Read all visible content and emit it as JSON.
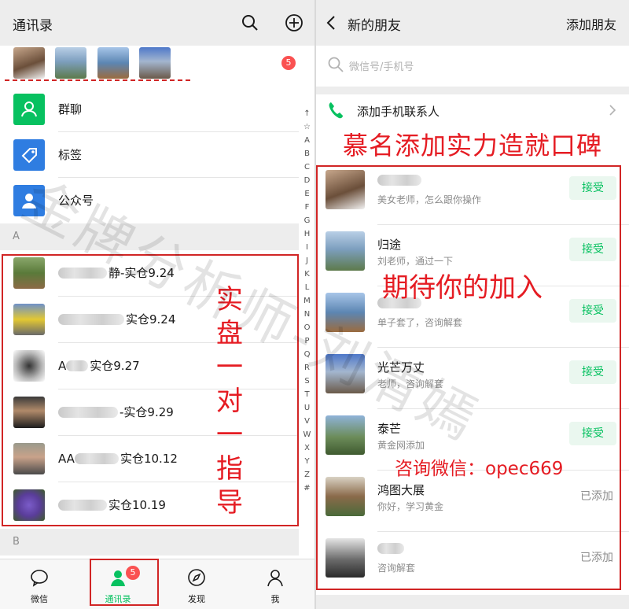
{
  "left": {
    "title": "通讯录",
    "new_friends_badge": "5",
    "menu": [
      {
        "label": "群聊",
        "icon": "group-chat-icon",
        "color": "#07c160"
      },
      {
        "label": "标签",
        "icon": "tag-icon",
        "color": "#2f7de1"
      },
      {
        "label": "公众号",
        "icon": "official-account-icon",
        "color": "#2f7de1"
      }
    ],
    "section_a": "A",
    "section_b": "B",
    "contacts": [
      {
        "prefix": "",
        "suffix": "静-实仓9.24"
      },
      {
        "prefix": "",
        "suffix": "实仓9.24"
      },
      {
        "prefix": "A",
        "suffix": "实仓9.27"
      },
      {
        "prefix": "",
        "suffix": "-实仓9.29"
      },
      {
        "prefix": "AA",
        "suffix": "实仓10.12"
      },
      {
        "prefix": "",
        "suffix": "实仓10.19"
      }
    ],
    "alphabet": [
      "↑",
      "☆",
      "A",
      "B",
      "C",
      "D",
      "E",
      "F",
      "G",
      "H",
      "I",
      "J",
      "K",
      "L",
      "M",
      "N",
      "O",
      "P",
      "Q",
      "R",
      "S",
      "T",
      "U",
      "V",
      "W",
      "X",
      "Y",
      "Z",
      "#"
    ],
    "tabs": [
      {
        "label": "微信",
        "icon": "chat-icon"
      },
      {
        "label": "通讯录",
        "icon": "contacts-icon",
        "badge": "5"
      },
      {
        "label": "发现",
        "icon": "compass-icon"
      },
      {
        "label": "我",
        "icon": "me-icon"
      }
    ],
    "overlay_vertical": [
      "实",
      "盘",
      "一",
      "对",
      "一",
      "指",
      "导"
    ]
  },
  "right": {
    "title": "新的朋友",
    "add_friends": "添加朋友",
    "search_placeholder": "微信号/手机号",
    "add_phone_contacts": "添加手机联系人",
    "overlay_headline": "慕名添加实力造就口碑",
    "overlay_join": "期待你的加入",
    "overlay_contact": "咨询微信：opec669",
    "requests": [
      {
        "name": "",
        "sub": "美女老师，怎么跟你操作",
        "action": "接受"
      },
      {
        "name": "归途",
        "sub": "刘老师，通过一下",
        "action": "接受"
      },
      {
        "name": "",
        "sub": "单子套了，咨询解套",
        "action": "接受"
      },
      {
        "name": "光芒万丈",
        "sub": "老师，咨询解套",
        "action": "接受"
      },
      {
        "name": "泰芒",
        "sub": "黄金网添加",
        "action": "接受"
      },
      {
        "name": "鸿图大展",
        "sub": "你好，学习黄金",
        "action": "已添加"
      },
      {
        "name": "",
        "sub": "咨询解套",
        "action": "已添加"
      }
    ]
  },
  "watermark": "金牌分析师-刘清嫣",
  "colors": {
    "wechat_green": "#07c160",
    "annotation_red": "#e51c23",
    "badge_red": "#fa5151"
  }
}
